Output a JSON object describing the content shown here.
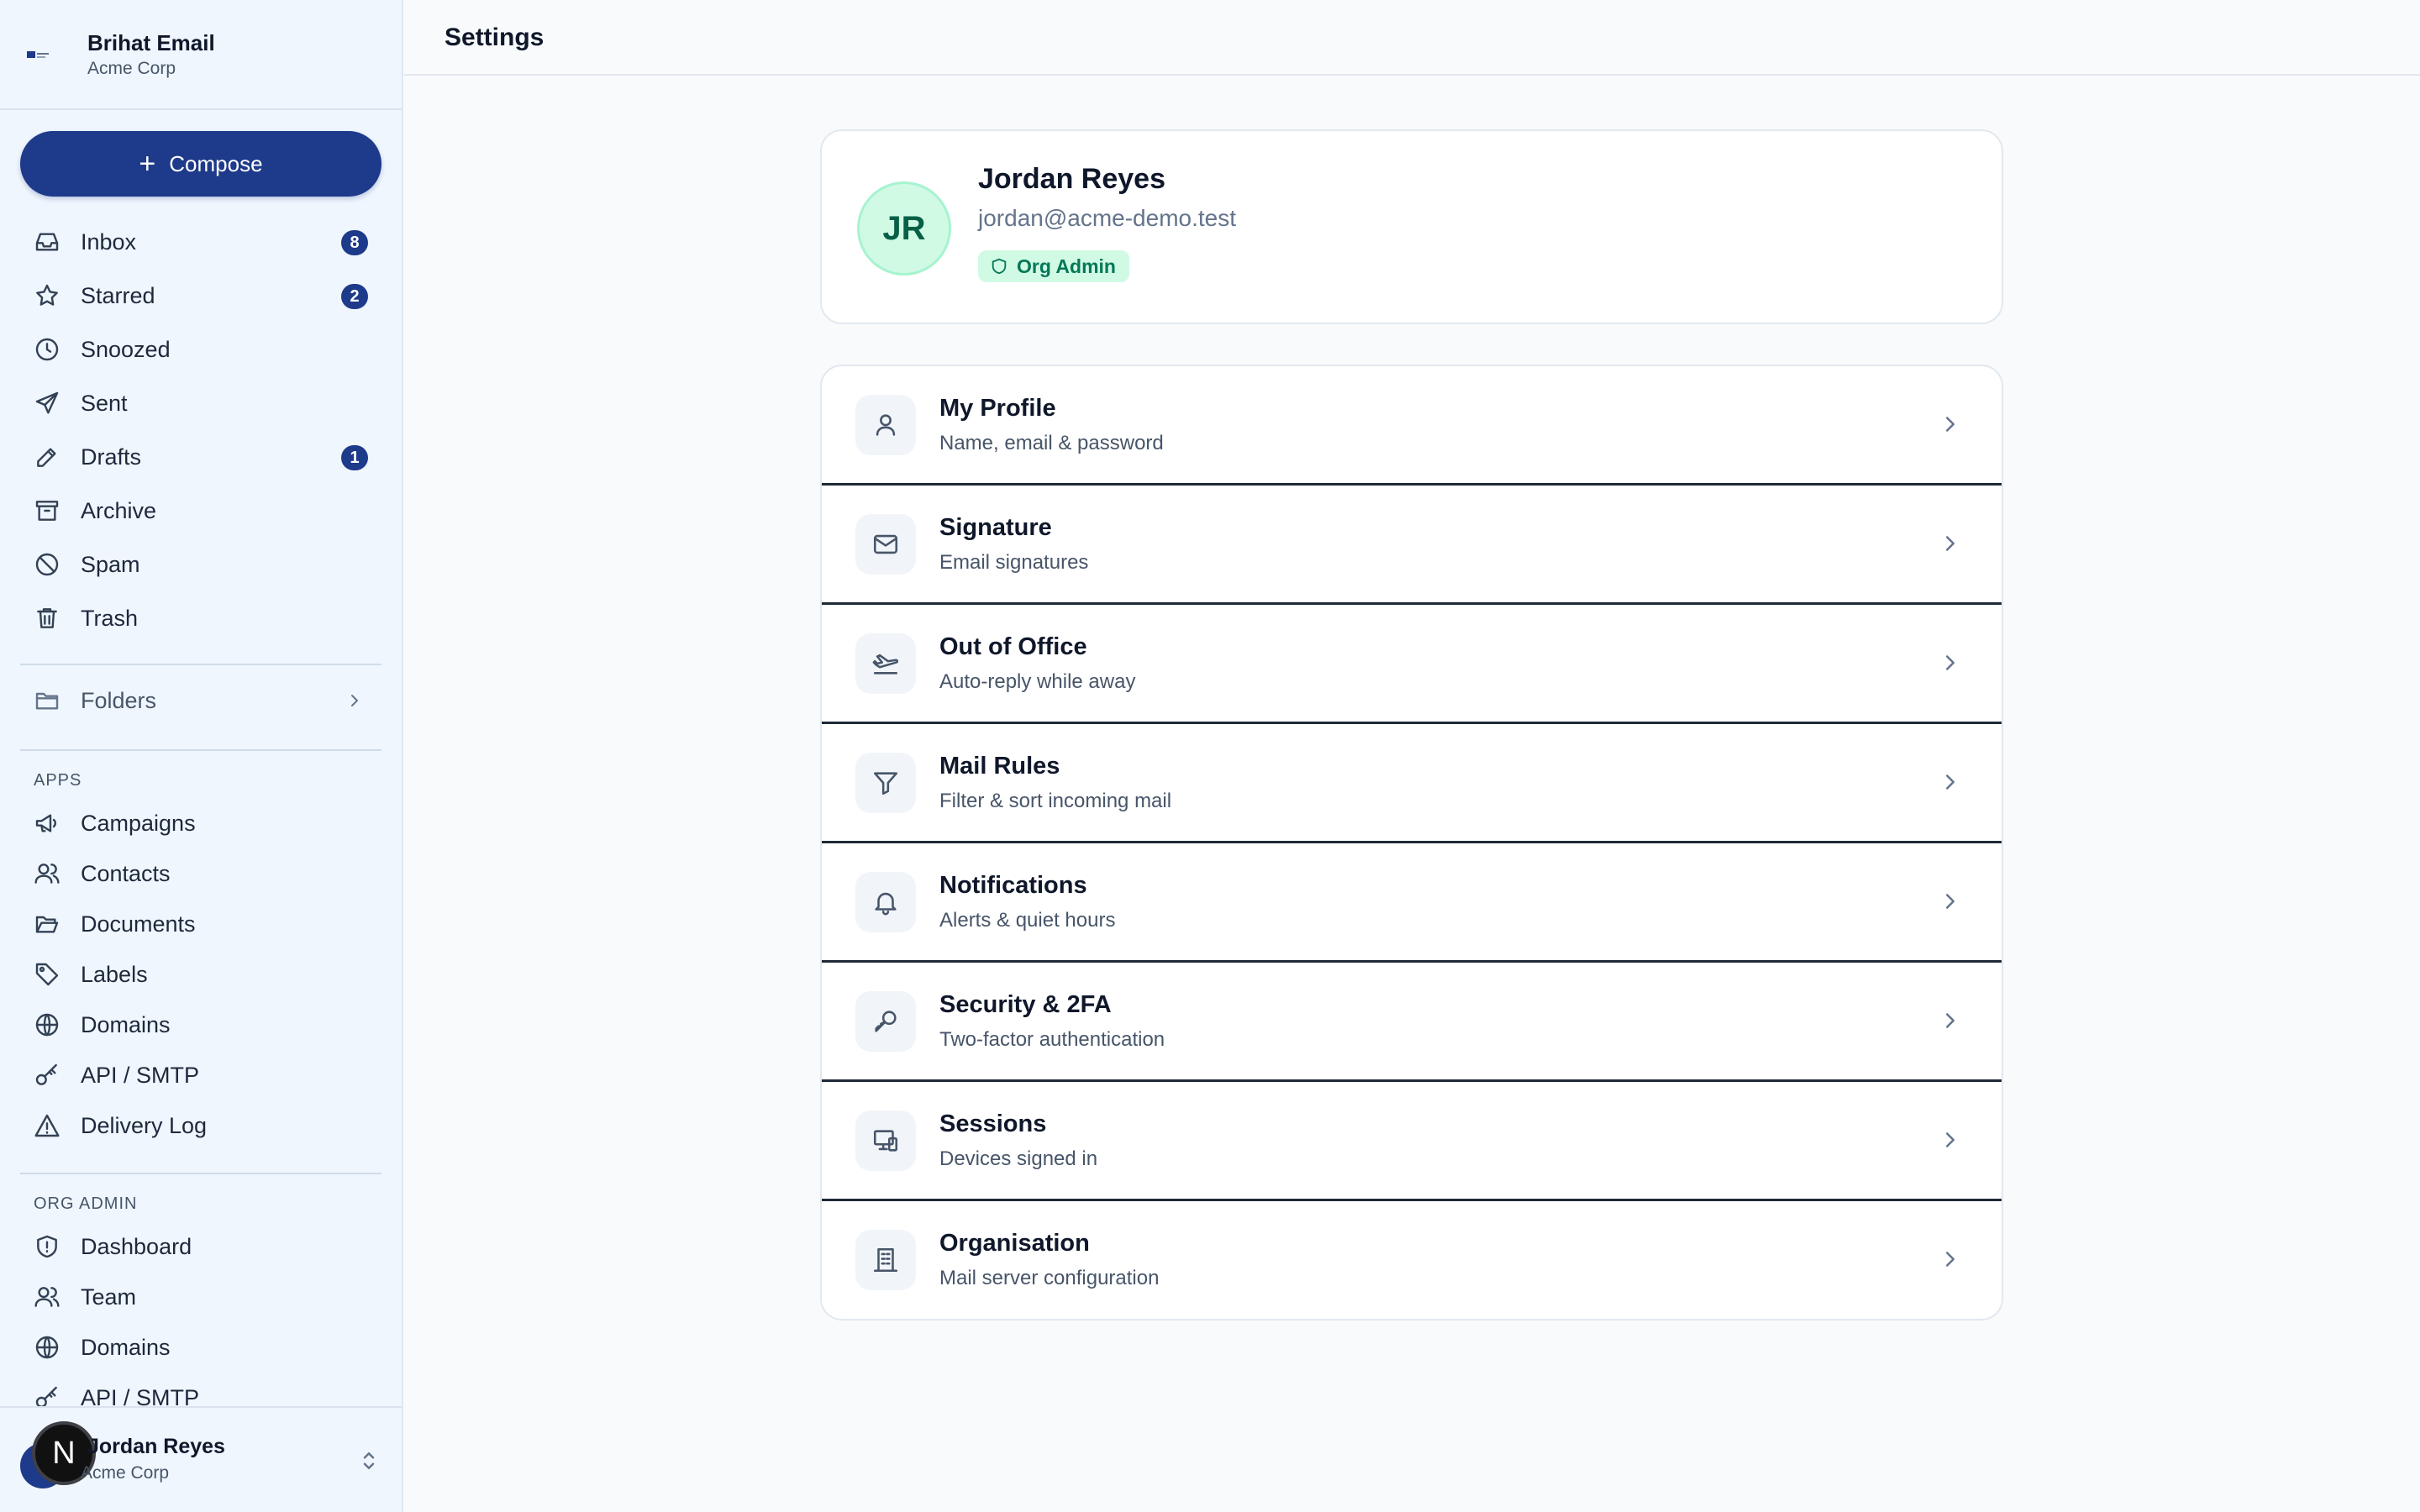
{
  "brand": {
    "name": "Brihat Email",
    "org": "Acme Corp"
  },
  "compose": {
    "label": "Compose"
  },
  "mail_nav": [
    {
      "label": "Inbox",
      "icon": "inbox-icon",
      "badge": "8"
    },
    {
      "label": "Starred",
      "icon": "star-icon",
      "badge": "2"
    },
    {
      "label": "Snoozed",
      "icon": "clock-icon",
      "badge": null
    },
    {
      "label": "Sent",
      "icon": "send-icon",
      "badge": null
    },
    {
      "label": "Drafts",
      "icon": "pencil-icon",
      "badge": "1"
    },
    {
      "label": "Archive",
      "icon": "archive-icon",
      "badge": null
    },
    {
      "label": "Spam",
      "icon": "ban-icon",
      "badge": null
    },
    {
      "label": "Trash",
      "icon": "trash-icon",
      "badge": null
    }
  ],
  "folders": {
    "label": "Folders"
  },
  "apps": {
    "heading": "APPS",
    "items": [
      {
        "label": "Campaigns",
        "icon": "megaphone-icon"
      },
      {
        "label": "Contacts",
        "icon": "users-icon"
      },
      {
        "label": "Documents",
        "icon": "folder-open-icon"
      },
      {
        "label": "Labels",
        "icon": "tag-icon"
      },
      {
        "label": "Domains",
        "icon": "globe-icon"
      },
      {
        "label": "API / SMTP",
        "icon": "key-icon"
      },
      {
        "label": "Delivery Log",
        "icon": "warning-icon"
      }
    ]
  },
  "org_admin": {
    "heading": "ORG ADMIN",
    "items": [
      {
        "label": "Dashboard",
        "icon": "shield-icon"
      },
      {
        "label": "Team",
        "icon": "users-icon"
      },
      {
        "label": "Domains",
        "icon": "globe-icon"
      },
      {
        "label": "API / SMTP",
        "icon": "key-icon"
      }
    ]
  },
  "user": {
    "name": "Jordan Reyes",
    "org": "Acme Corp",
    "overlay_initial": "N"
  },
  "header": {
    "title": "Settings"
  },
  "profile": {
    "initials": "JR",
    "name": "Jordan Reyes",
    "email": "jordan@acme-demo.test",
    "role": "Org Admin"
  },
  "settings_rows": [
    {
      "title": "My Profile",
      "subtitle": "Name, email & password",
      "icon": "user-icon"
    },
    {
      "title": "Signature",
      "subtitle": "Email signatures",
      "icon": "mail-icon"
    },
    {
      "title": "Out of Office",
      "subtitle": "Auto-reply while away",
      "icon": "plane-icon"
    },
    {
      "title": "Mail Rules",
      "subtitle": "Filter & sort incoming mail",
      "icon": "filter-icon"
    },
    {
      "title": "Notifications",
      "subtitle": "Alerts & quiet hours",
      "icon": "bell-icon"
    },
    {
      "title": "Security & 2FA",
      "subtitle": "Two-factor authentication",
      "icon": "key-icon"
    },
    {
      "title": "Sessions",
      "subtitle": "Devices signed in",
      "icon": "devices-icon"
    },
    {
      "title": "Organisation",
      "subtitle": "Mail server configuration",
      "icon": "building-icon"
    }
  ],
  "colors": {
    "brand": "#1e3a8a",
    "sidebar_bg": "#eff6fd",
    "role_chip_bg": "#d1fae5",
    "role_chip_text": "#047857"
  }
}
